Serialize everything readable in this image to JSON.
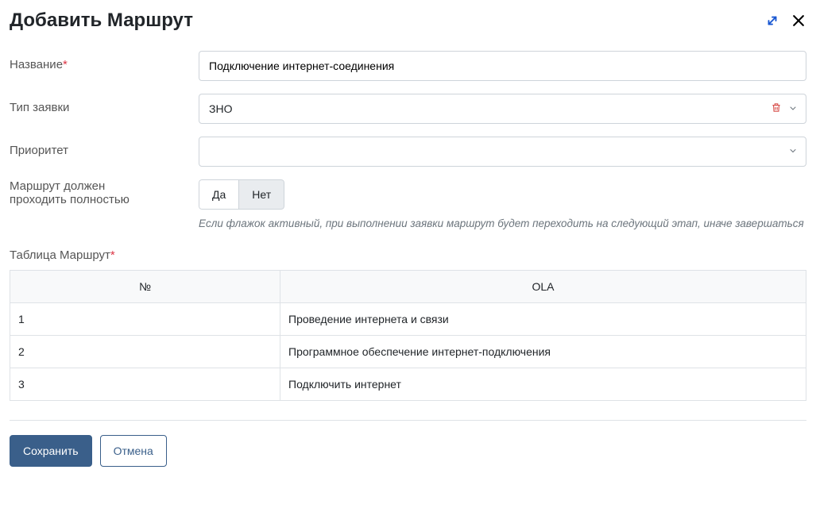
{
  "title": "Добавить Маршрут",
  "labels": {
    "name": "Название",
    "request_type": "Тип заявки",
    "priority": "Приоритет",
    "route_full_l1": "Маршрут должен",
    "route_full_l2": "проходить полностью",
    "route_table": "Таблица Маршрут"
  },
  "required_mark": "*",
  "fields": {
    "name_value": "Подключение интернет-соединения",
    "request_type_value": "ЗНО",
    "priority_value": ""
  },
  "toggle": {
    "yes": "Да",
    "no": "Нет"
  },
  "helper_text": "Если флажок активный, при выполнении заявки маршрут будет переходить на следующий этап, иначе завершаться",
  "table": {
    "headers": {
      "no": "№",
      "ola": "OLA"
    },
    "rows": [
      {
        "no": "1",
        "ola": "Проведение интернета и связи"
      },
      {
        "no": "2",
        "ola": "Программное обеспечение интернет-подключения"
      },
      {
        "no": "3",
        "ola": "Подключить интернет"
      }
    ]
  },
  "buttons": {
    "save": "Сохранить",
    "cancel": "Отмена"
  }
}
